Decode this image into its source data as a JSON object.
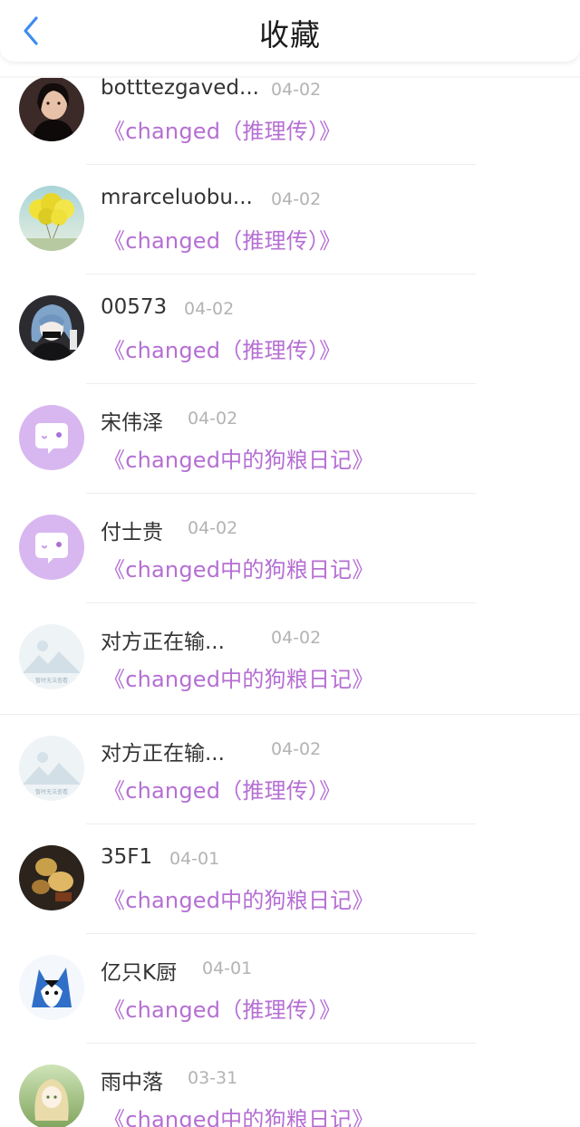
{
  "header": {
    "title": "收藏",
    "back_icon": "chevron-left-icon",
    "accent_color": "#3d8cf0"
  },
  "colors": {
    "book_title": "#b56fd3",
    "date": "#b3b3b3",
    "name": "#333333"
  },
  "favorites": [
    {
      "name": "botttezgaved...",
      "date": "04-02",
      "book": "《changed（推理传）》",
      "avatar": "photo-avatar"
    },
    {
      "name": "mrarceluobu...",
      "date": "04-02",
      "book": "《changed（推理传）》",
      "avatar": "yellow-balloons-avatar"
    },
    {
      "name": "00573",
      "date": "04-02",
      "book": "《changed（推理传）》",
      "avatar": "anime-character-avatar"
    },
    {
      "name": "宋伟泽",
      "date": "04-02",
      "book": "《changed中的狗粮日记》",
      "avatar": "default-chat-bubble-avatar"
    },
    {
      "name": "付士贵",
      "date": "04-02",
      "book": "《changed中的狗粮日记》",
      "avatar": "default-chat-bubble-avatar"
    },
    {
      "name": "对方正在输...",
      "date": "04-02",
      "book": "《changed中的狗粮日记》",
      "avatar": "image-unavailable-avatar",
      "avatar_caption": "暂时无法查看"
    },
    {
      "name": "对方正在输...",
      "date": "04-02",
      "book": "《changed（推理传）》",
      "avatar": "image-unavailable-avatar",
      "avatar_caption": "暂时无法查看"
    },
    {
      "name": "35F1",
      "date": "04-01",
      "book": "《changed中的狗粮日记》",
      "avatar": "food-photo-avatar"
    },
    {
      "name": "亿只K厨",
      "date": "04-01",
      "book": "《changed（推理传）》",
      "avatar": "wolf-character-avatar"
    },
    {
      "name": "雨中落",
      "date": "03-31",
      "book": "《changed中的狗粮日记》",
      "avatar": "green-anime-avatar"
    }
  ]
}
